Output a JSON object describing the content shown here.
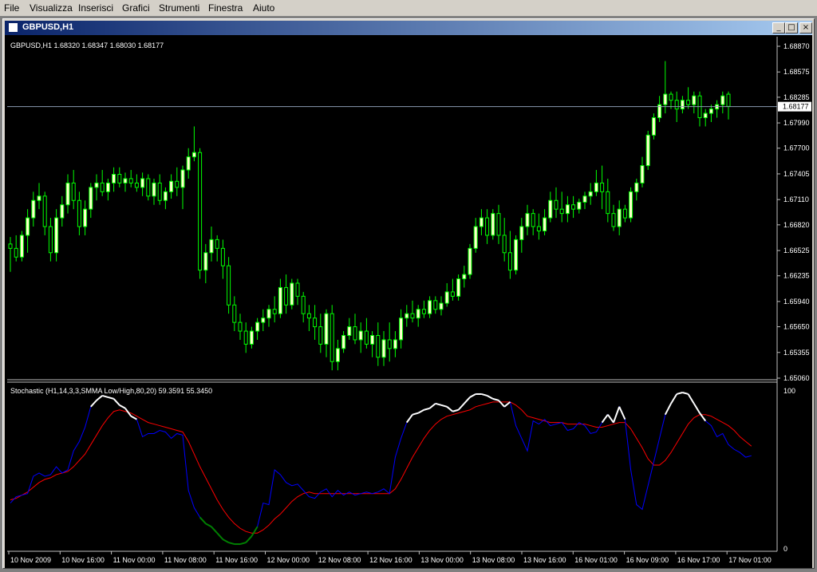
{
  "menu": [
    "File",
    "Visualizza",
    "Inserisci",
    "Grafici",
    "Strumenti",
    "Finestra",
    "Aiuto"
  ],
  "window": {
    "title": "GBPUSD,H1",
    "buttons": [
      "_",
      "□",
      "×"
    ]
  },
  "price_panel": {
    "info": "GBPUSD,H1  1.68320 1.68347 1.68030 1.68177",
    "current_price": "1.68177",
    "axis_labels": [
      "1.68870",
      "1.68575",
      "1.68285",
      "1.67990",
      "1.67700",
      "1.67405",
      "1.67110",
      "1.66820",
      "1.66525",
      "1.66235",
      "1.65940",
      "1.65650",
      "1.65355",
      "1.65060"
    ]
  },
  "indicator_panel": {
    "info": "Stochastic (H1,14,3,3,SMMA Low/High,80,20) 59.3591 55.3450",
    "axis_labels": [
      "100",
      "0"
    ]
  },
  "time_axis": [
    "10 Nov 2009",
    "10 Nov 16:00",
    "11 Nov 00:00",
    "11 Nov 08:00",
    "11 Nov 16:00",
    "12 Nov 00:00",
    "12 Nov 08:00",
    "12 Nov 16:00",
    "13 Nov 00:00",
    "13 Nov 08:00",
    "13 Nov 16:00",
    "16 Nov 01:00",
    "16 Nov 09:00",
    "16 Nov 17:00",
    "17 Nov 01:00"
  ],
  "colors": {
    "background": "#000000",
    "bull_candle": "#ffffcc",
    "bear_candle": "#000000",
    "candle_wick": "#00ff00",
    "stoch_main": "#0000ff",
    "stoch_signal": "#ff0000",
    "stoch_overbought": "#ffffff",
    "stoch_oversold": "#008000"
  },
  "chart_data": {
    "type": "candlestick",
    "symbol": "GBPUSD",
    "timeframe": "H1",
    "ylim": [
      1.6506,
      1.6887
    ],
    "candles": [
      [
        1.666,
        1.6668,
        1.6628,
        1.6655
      ],
      [
        1.6655,
        1.667,
        1.664,
        1.6645
      ],
      [
        1.6645,
        1.6675,
        1.664,
        1.667
      ],
      [
        1.667,
        1.67,
        1.665,
        1.669
      ],
      [
        1.669,
        1.672,
        1.668,
        1.671
      ],
      [
        1.671,
        1.673,
        1.67,
        1.6715
      ],
      [
        1.6715,
        1.672,
        1.667,
        1.668
      ],
      [
        1.668,
        1.669,
        1.664,
        1.665
      ],
      [
        1.665,
        1.67,
        1.664,
        1.669
      ],
      [
        1.669,
        1.6715,
        1.668,
        1.6705
      ],
      [
        1.6705,
        1.674,
        1.6695,
        1.673
      ],
      [
        1.673,
        1.6745,
        1.67,
        1.671
      ],
      [
        1.671,
        1.672,
        1.667,
        1.668
      ],
      [
        1.668,
        1.671,
        1.667,
        1.67
      ],
      [
        1.67,
        1.673,
        1.669,
        1.6725
      ],
      [
        1.6725,
        1.674,
        1.671,
        1.673
      ],
      [
        1.673,
        1.6745,
        1.6715,
        1.672
      ],
      [
        1.672,
        1.6735,
        1.671,
        1.673
      ],
      [
        1.673,
        1.6748,
        1.672,
        1.674
      ],
      [
        1.674,
        1.6748,
        1.6725,
        1.673
      ],
      [
        1.673,
        1.6742,
        1.672,
        1.6735
      ],
      [
        1.6735,
        1.6745,
        1.6725,
        1.673
      ],
      [
        1.673,
        1.674,
        1.672,
        1.6725
      ],
      [
        1.6725,
        1.6742,
        1.6715,
        1.6735
      ],
      [
        1.6735,
        1.674,
        1.671,
        1.6715
      ],
      [
        1.6715,
        1.6735,
        1.6705,
        1.673
      ],
      [
        1.673,
        1.674,
        1.6705,
        1.671
      ],
      [
        1.671,
        1.6725,
        1.67,
        1.672
      ],
      [
        1.672,
        1.674,
        1.6712,
        1.6732
      ],
      [
        1.6732,
        1.6748,
        1.6715,
        1.6725
      ],
      [
        1.6725,
        1.675,
        1.67,
        1.6745
      ],
      [
        1.6745,
        1.677,
        1.6735,
        1.676
      ],
      [
        1.676,
        1.6795,
        1.6755,
        1.6765
      ],
      [
        1.6765,
        1.677,
        1.662,
        1.663
      ],
      [
        1.663,
        1.666,
        1.6615,
        1.665
      ],
      [
        1.665,
        1.668,
        1.664,
        1.6665
      ],
      [
        1.6665,
        1.667,
        1.664,
        1.6655
      ],
      [
        1.6655,
        1.6665,
        1.662,
        1.6635
      ],
      [
        1.6635,
        1.6645,
        1.658,
        1.659
      ],
      [
        1.659,
        1.66,
        1.656,
        1.657
      ],
      [
        1.657,
        1.658,
        1.655,
        1.656
      ],
      [
        1.656,
        1.657,
        1.6535,
        1.6545
      ],
      [
        1.6545,
        1.6565,
        1.654,
        1.656
      ],
      [
        1.656,
        1.6575,
        1.655,
        1.657
      ],
      [
        1.657,
        1.6585,
        1.656,
        1.6575
      ],
      [
        1.6575,
        1.659,
        1.6565,
        1.6585
      ],
      [
        1.6585,
        1.66,
        1.657,
        1.658
      ],
      [
        1.658,
        1.662,
        1.6575,
        1.661
      ],
      [
        1.661,
        1.6625,
        1.658,
        1.659
      ],
      [
        1.659,
        1.662,
        1.6585,
        1.6615
      ],
      [
        1.6615,
        1.662,
        1.659,
        1.66
      ],
      [
        1.66,
        1.6605,
        1.657,
        1.658
      ],
      [
        1.658,
        1.659,
        1.656,
        1.6575
      ],
      [
        1.6575,
        1.659,
        1.655,
        1.6565
      ],
      [
        1.6565,
        1.658,
        1.6535,
        1.6545
      ],
      [
        1.6545,
        1.6585,
        1.653,
        1.658
      ],
      [
        1.658,
        1.659,
        1.6515,
        1.6525
      ],
      [
        1.6525,
        1.655,
        1.6515,
        1.654
      ],
      [
        1.654,
        1.656,
        1.6535,
        1.6555
      ],
      [
        1.6555,
        1.6575,
        1.655,
        1.6565
      ],
      [
        1.6565,
        1.658,
        1.6545,
        1.655
      ],
      [
        1.655,
        1.657,
        1.6535,
        1.656
      ],
      [
        1.656,
        1.6575,
        1.654,
        1.6545
      ],
      [
        1.6545,
        1.656,
        1.653,
        1.6555
      ],
      [
        1.6555,
        1.657,
        1.652,
        1.653
      ],
      [
        1.653,
        1.656,
        1.652,
        1.655
      ],
      [
        1.655,
        1.657,
        1.6525,
        1.654
      ],
      [
        1.654,
        1.656,
        1.653,
        1.655
      ],
      [
        1.655,
        1.6585,
        1.654,
        1.6575
      ],
      [
        1.6575,
        1.659,
        1.6565,
        1.658
      ],
      [
        1.658,
        1.6595,
        1.657,
        1.6575
      ],
      [
        1.6575,
        1.659,
        1.6565,
        1.6585
      ],
      [
        1.6585,
        1.6595,
        1.6575,
        1.658
      ],
      [
        1.658,
        1.66,
        1.6575,
        1.6595
      ],
      [
        1.6595,
        1.66,
        1.658,
        1.6585
      ],
      [
        1.6585,
        1.66,
        1.6578,
        1.6592
      ],
      [
        1.6592,
        1.6615,
        1.6588,
        1.6605
      ],
      [
        1.6605,
        1.662,
        1.6595,
        1.66
      ],
      [
        1.66,
        1.6625,
        1.6595,
        1.662
      ],
      [
        1.662,
        1.6635,
        1.661,
        1.6625
      ],
      [
        1.6625,
        1.666,
        1.662,
        1.6655
      ],
      [
        1.6655,
        1.669,
        1.665,
        1.668
      ],
      [
        1.668,
        1.67,
        1.667,
        1.669
      ],
      [
        1.669,
        1.67,
        1.666,
        1.667
      ],
      [
        1.667,
        1.67,
        1.6665,
        1.6695
      ],
      [
        1.6695,
        1.6705,
        1.666,
        1.667
      ],
      [
        1.667,
        1.669,
        1.664,
        1.665
      ],
      [
        1.665,
        1.6675,
        1.662,
        1.663
      ],
      [
        1.663,
        1.667,
        1.6625,
        1.6665
      ],
      [
        1.6665,
        1.669,
        1.665,
        1.668
      ],
      [
        1.668,
        1.6705,
        1.667,
        1.6695
      ],
      [
        1.6695,
        1.67,
        1.667,
        1.668
      ],
      [
        1.668,
        1.6695,
        1.6665,
        1.6675
      ],
      [
        1.6675,
        1.67,
        1.667,
        1.669
      ],
      [
        1.669,
        1.672,
        1.6685,
        1.671
      ],
      [
        1.671,
        1.6725,
        1.669,
        1.67
      ],
      [
        1.67,
        1.672,
        1.6685,
        1.6695
      ],
      [
        1.6695,
        1.6715,
        1.6685,
        1.6705
      ],
      [
        1.6705,
        1.6715,
        1.669,
        1.67
      ],
      [
        1.67,
        1.6712,
        1.6695,
        1.6708
      ],
      [
        1.6708,
        1.672,
        1.67,
        1.6715
      ],
      [
        1.6715,
        1.673,
        1.6705,
        1.672
      ],
      [
        1.672,
        1.6745,
        1.6715,
        1.673
      ],
      [
        1.673,
        1.675,
        1.67,
        1.672
      ],
      [
        1.672,
        1.6735,
        1.6685,
        1.6695
      ],
      [
        1.6695,
        1.6705,
        1.6675,
        1.668
      ],
      [
        1.668,
        1.671,
        1.667,
        1.67
      ],
      [
        1.67,
        1.6705,
        1.6685,
        1.669
      ],
      [
        1.669,
        1.6725,
        1.6685,
        1.672
      ],
      [
        1.672,
        1.6735,
        1.671,
        1.673
      ],
      [
        1.673,
        1.676,
        1.6725,
        1.675
      ],
      [
        1.675,
        1.679,
        1.6745,
        1.6785
      ],
      [
        1.6785,
        1.681,
        1.678,
        1.6805
      ],
      [
        1.6805,
        1.683,
        1.68,
        1.682
      ],
      [
        1.682,
        1.687,
        1.681,
        1.6832
      ],
      [
        1.6832,
        1.6835,
        1.6815,
        1.6825
      ],
      [
        1.6825,
        1.6835,
        1.68,
        1.6815
      ],
      [
        1.6815,
        1.683,
        1.681,
        1.6825
      ],
      [
        1.6825,
        1.684,
        1.6815,
        1.682
      ],
      [
        1.682,
        1.6835,
        1.681,
        1.683
      ],
      [
        1.683,
        1.6835,
        1.6795,
        1.6805
      ],
      [
        1.6805,
        1.6815,
        1.6795,
        1.681
      ],
      [
        1.681,
        1.682,
        1.68,
        1.6815
      ],
      [
        1.6815,
        1.6825,
        1.6805,
        1.682
      ],
      [
        1.682,
        1.6835,
        1.681,
        1.683
      ],
      [
        1.6832,
        1.6835,
        1.6803,
        1.6818
      ]
    ],
    "stochastic": {
      "main": [
        29,
        33,
        34,
        35,
        46,
        48,
        46,
        47,
        52,
        48,
        50,
        62,
        68,
        77,
        90,
        94,
        97,
        96,
        95,
        91,
        89,
        84,
        82,
        71,
        73,
        73,
        75,
        74,
        70,
        73,
        72,
        37,
        26,
        20,
        16,
        14,
        10,
        6,
        4,
        3,
        3,
        4,
        8,
        14,
        29,
        28,
        50,
        47,
        42,
        40,
        41,
        37,
        33,
        32,
        36,
        38,
        33,
        37,
        34,
        36,
        34,
        35,
        36,
        35,
        36,
        38,
        35,
        58,
        70,
        80,
        85,
        86,
        88,
        89,
        92,
        91,
        90,
        87,
        88,
        92,
        96,
        98,
        98,
        97,
        95,
        94,
        90,
        93,
        78,
        70,
        62,
        81,
        79,
        82,
        78,
        79,
        80,
        75,
        76,
        80,
        78,
        73,
        74,
        80,
        85,
        80,
        90,
        82,
        50,
        28,
        25,
        40,
        55,
        70,
        85,
        92,
        98,
        99,
        98,
        92,
        86,
        81,
        78,
        71,
        73,
        66,
        63,
        61,
        58,
        59
      ],
      "signal": [
        31,
        32,
        34,
        36,
        39,
        42,
        44,
        45,
        47,
        48,
        49,
        52,
        56,
        60,
        66,
        72,
        78,
        83,
        87,
        88,
        87,
        86,
        84,
        82,
        80,
        79,
        78,
        77,
        76,
        75,
        74,
        68,
        60,
        52,
        45,
        38,
        31,
        25,
        20,
        16,
        13,
        11,
        10,
        10,
        12,
        15,
        19,
        22,
        26,
        30,
        33,
        35,
        36,
        35,
        35,
        35,
        35,
        35,
        35,
        35,
        35,
        35,
        35,
        35,
        35,
        35,
        35,
        38,
        44,
        51,
        58,
        64,
        70,
        75,
        79,
        82,
        84,
        85,
        86,
        87,
        88,
        90,
        91,
        92,
        93,
        93,
        93,
        93,
        91,
        88,
        84,
        83,
        82,
        81,
        80,
        80,
        80,
        79,
        79,
        79,
        79,
        78,
        77,
        77,
        78,
        79,
        80,
        80,
        76,
        70,
        64,
        57,
        53,
        53,
        56,
        61,
        67,
        73,
        79,
        83,
        85,
        85,
        84,
        82,
        80,
        78,
        75,
        71,
        68,
        65
      ]
    }
  }
}
